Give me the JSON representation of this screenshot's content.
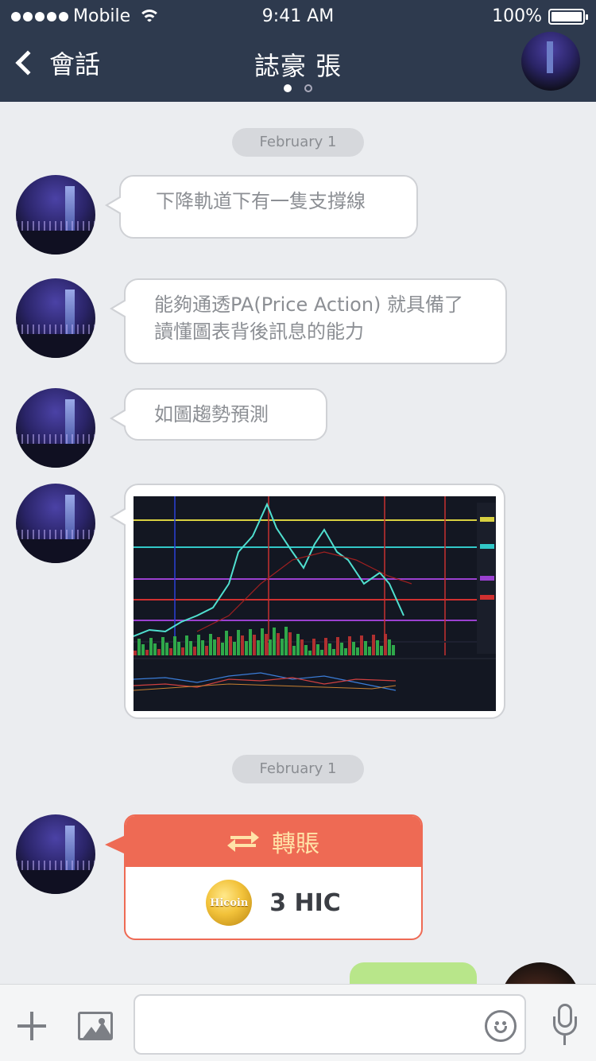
{
  "status_bar": {
    "carrier": "Mobile",
    "time": "9:41 AM",
    "battery": "100%"
  },
  "header": {
    "back_label": "會話",
    "title": "誌豪 張",
    "page_indicator": {
      "count": 2,
      "active_index": 0
    }
  },
  "messages": [
    {
      "type": "date",
      "text": "February 1"
    },
    {
      "type": "text",
      "from": "contact",
      "text": "下降軌道下有一隻支撐線"
    },
    {
      "type": "text",
      "from": "contact",
      "lines": [
        "能夠通透PA(Price Action) 就具備了",
        "讀懂圖表背後訊息的能力"
      ]
    },
    {
      "type": "text",
      "from": "contact",
      "text": "如圖趨勢預測"
    },
    {
      "type": "image",
      "from": "contact",
      "image": "price-chart-image"
    },
    {
      "type": "date",
      "text": "February 1"
    },
    {
      "type": "transfer",
      "from": "contact",
      "title": "轉賬",
      "coin_label": "Hicoin",
      "amount": "3 HIC"
    },
    {
      "type": "text",
      "from": "me",
      "text": ""
    }
  ],
  "input_bar": {
    "placeholder": "",
    "value": ""
  },
  "icons": [
    "back-chevron-icon",
    "plus-icon",
    "image-icon",
    "emoji-icon",
    "microphone-icon",
    "swap-arrows-icon",
    "hicoin-coin-icon"
  ],
  "colors": {
    "header_bg": "#2e3a4e",
    "chat_bg": "#ebedf0",
    "transfer_accent": "#ee6a54",
    "my_bubble": "#b8e68a"
  }
}
